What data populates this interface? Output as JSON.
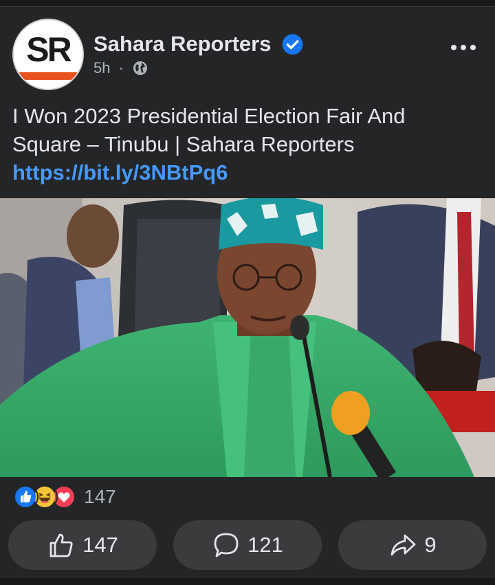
{
  "post": {
    "page_name": "Sahara Reporters",
    "avatar_text": "SR",
    "time": "5h",
    "separator": "·",
    "text": "I Won 2023 Presidential Election Fair And Square – Tinubu | Sahara Reporters ",
    "link": "https://bit.ly/3NBtPq6"
  },
  "reactions": {
    "icons": [
      "like-reaction-icon",
      "haha-reaction-icon",
      "love-reaction-icon"
    ],
    "count": "147"
  },
  "actions": {
    "like_count": "147",
    "comment_count": "121",
    "share_count": "9"
  },
  "colors": {
    "background": "#242526",
    "link": "#4599ff",
    "verified": "#1877f2",
    "brand_bar": "#e8521f"
  }
}
